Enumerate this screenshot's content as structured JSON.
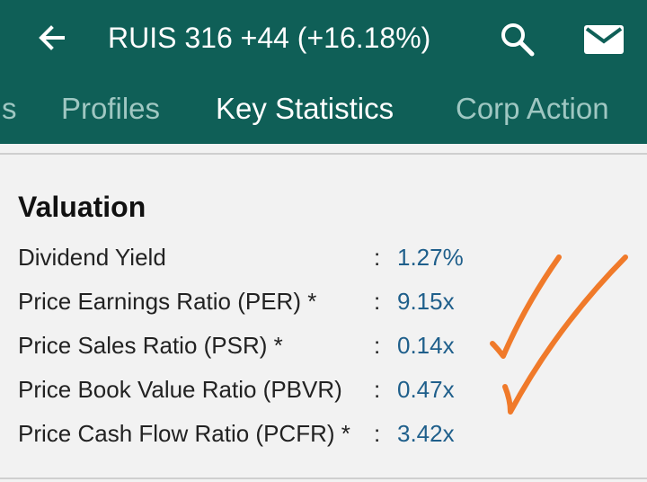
{
  "header": {
    "title": "RUIS  316 +44 (+16.18%)",
    "icons": [
      "back-arrow-icon",
      "search-icon",
      "mail-icon"
    ]
  },
  "tabs": [
    {
      "label": "s",
      "active": false
    },
    {
      "label": "Profiles",
      "active": false
    },
    {
      "label": "Key Statistics",
      "active": true
    },
    {
      "label": "Corp Action",
      "active": false
    }
  ],
  "valuation": {
    "title": "Valuation",
    "rows": [
      {
        "label": "Dividend Yield",
        "value": "1.27%"
      },
      {
        "label": "Price Earnings Ratio (PER) *",
        "value": "9.15x"
      },
      {
        "label": "Price Sales Ratio (PSR) *",
        "value": "0.14x"
      },
      {
        "label": "Price Book Value Ratio (PBVR)",
        "value": "0.47x"
      },
      {
        "label": "Price Cash Flow Ratio (PCFR) *",
        "value": "3.42x"
      }
    ]
  },
  "colors": {
    "appbar": "#0f5f57",
    "value_text": "#1f5f8b",
    "checkmark": "#f07a2a"
  }
}
